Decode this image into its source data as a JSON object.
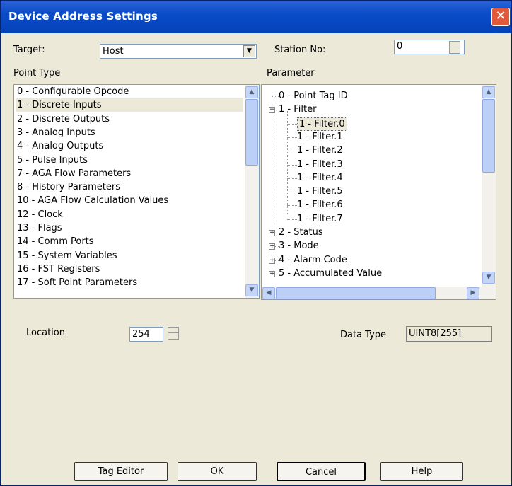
{
  "window": {
    "title": "Device Address Settings",
    "close_symbol": "✕"
  },
  "target": {
    "label": "Target:",
    "value": "Host"
  },
  "station": {
    "label": "Station No:",
    "value": "0"
  },
  "point_type": {
    "label": "Point Type",
    "selected_index": 1,
    "items": [
      "0 - Configurable Opcode",
      "1 - Discrete Inputs",
      "2 - Discrete Outputs",
      "3 - Analog Inputs",
      "4 - Analog Outputs",
      "5 - Pulse Inputs",
      "7 - AGA Flow Parameters",
      "8 - History Parameters",
      "10 - AGA Flow Calculation Values",
      "12 - Clock",
      "13 - Flags",
      "14 - Comm Ports",
      "15 - System Variables",
      "16 - FST Registers",
      "17 - Soft Point Parameters"
    ]
  },
  "parameter": {
    "label": "Parameter",
    "items": [
      {
        "text": "0 - Point Tag ID",
        "level": 0,
        "expander": ""
      },
      {
        "text": "1 - Filter",
        "level": 0,
        "expander": "−"
      },
      {
        "text": "1 - Filter.0",
        "level": 1,
        "expander": "",
        "selected": true
      },
      {
        "text": "1 - Filter.1",
        "level": 1,
        "expander": ""
      },
      {
        "text": "1 - Filter.2",
        "level": 1,
        "expander": ""
      },
      {
        "text": "1 - Filter.3",
        "level": 1,
        "expander": ""
      },
      {
        "text": "1 - Filter.4",
        "level": 1,
        "expander": ""
      },
      {
        "text": "1 - Filter.5",
        "level": 1,
        "expander": ""
      },
      {
        "text": "1 - Filter.6",
        "level": 1,
        "expander": ""
      },
      {
        "text": "1 - Filter.7",
        "level": 1,
        "expander": ""
      },
      {
        "text": "2 - Status",
        "level": 0,
        "expander": "+"
      },
      {
        "text": "3 - Mode",
        "level": 0,
        "expander": "+"
      },
      {
        "text": "4 - Alarm Code",
        "level": 0,
        "expander": "+"
      },
      {
        "text": "5 - Accumulated Value",
        "level": 0,
        "expander": "+"
      }
    ]
  },
  "location": {
    "label": "Location",
    "value": "254"
  },
  "data_type": {
    "label": "Data Type",
    "value": "UINT8[255]"
  },
  "buttons": {
    "tag_editor": "Tag Editor",
    "ok": "OK",
    "cancel": "Cancel",
    "help": "Help"
  },
  "colors": {
    "titlebar": "#0a4cc8",
    "dialog_bg": "#ece9d8",
    "close": "#e25a3a"
  }
}
